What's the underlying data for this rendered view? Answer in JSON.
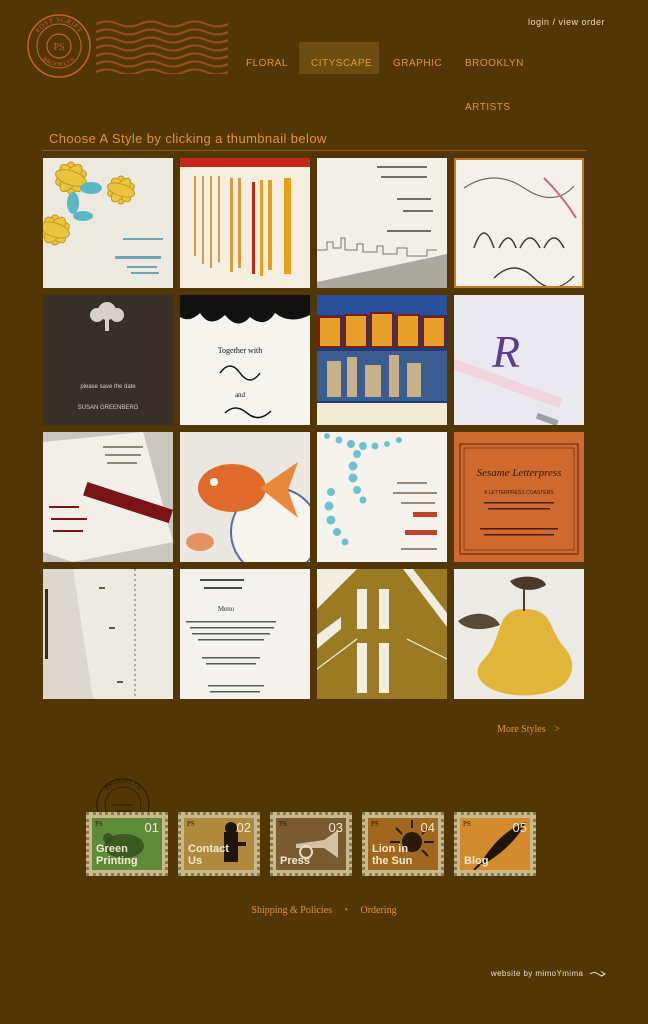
{
  "header": {
    "logo_text_top": "POST SCRIPT",
    "logo_text_bottom": "BROOKLYN",
    "logo_monogram": "PS",
    "login_label": "login",
    "separator": "/",
    "view_order_label": "view order"
  },
  "nav": {
    "tabs": [
      {
        "label": "FLORAL"
      },
      {
        "label": "CITYSCAPE"
      },
      {
        "label": "GRAPHIC"
      },
      {
        "label": "BROOKLYN ARTISTS"
      }
    ],
    "active_tab": "CITYSCAPE"
  },
  "main": {
    "heading": "Choose A Style by clicking a thumbnail below",
    "thumbnails": [
      {
        "name": "floral-blue-invitation"
      },
      {
        "name": "gabrielle-red-invitation"
      },
      {
        "name": "skyline-invitation"
      },
      {
        "name": "ms-aimee-calligraphy"
      },
      {
        "name": "tree-save-the-date",
        "text": "please save the date",
        "text2": "SUSAN GREENBERG"
      },
      {
        "name": "black-damask-invitation",
        "text": "Together with",
        "text2": "and"
      },
      {
        "name": "greetings-brooklyn-postcard"
      },
      {
        "name": "monogram-r-card"
      },
      {
        "name": "ribbon-invitation"
      },
      {
        "name": "goldfish-coaster"
      },
      {
        "name": "blue-dots-invitation"
      },
      {
        "name": "sesame-letterpress-coasters",
        "text": "Sesame Letterpress",
        "text2": "8 LETTERPRESS COASTERS"
      },
      {
        "name": "first-word-card"
      },
      {
        "name": "menu-card",
        "text": "Menu"
      },
      {
        "name": "bridge-illustration"
      },
      {
        "name": "pear-card"
      }
    ],
    "more_styles_label": "More Styles",
    "more_styles_arrow": ">"
  },
  "stamps": [
    {
      "number": "01",
      "label_line1": "Green",
      "label_line2": "Printing",
      "bg": "#5f8a3a"
    },
    {
      "number": "02",
      "label_line1": "Contact",
      "label_line2": "Us",
      "bg": "#b08a3c"
    },
    {
      "number": "03",
      "label_line1": "",
      "label_line2": "Press",
      "bg": "#7a5a30"
    },
    {
      "number": "04",
      "label_line1": "Lion in",
      "label_line2": "the Sun",
      "bg": "#a0681e"
    },
    {
      "number": "05",
      "label_line1": "",
      "label_line2": "Blog",
      "bg": "#d38a2c"
    }
  ],
  "stamp_ps": "PS",
  "postmark_text": "BROOKLYN",
  "footer": {
    "shipping_label": "Shipping & Policies",
    "dot": "•",
    "ordering_label": "Ordering",
    "credit": "website by mimoYmima"
  },
  "colors": {
    "background": "#523606",
    "accent": "#e5942e",
    "light_text": "#e8dcc6"
  }
}
